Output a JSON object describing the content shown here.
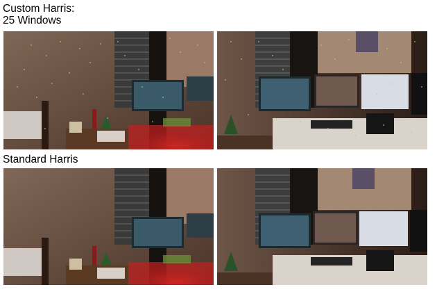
{
  "sections": {
    "custom": {
      "title_line1": "Custom Harris:",
      "title_line2": "25 Windows"
    },
    "standard": {
      "title": "Standard Harris"
    }
  },
  "images": [
    {
      "section": "custom",
      "view": "left-wide",
      "description": "Room corner with bed, christmas tree and red-lit desk with monitors, with corner detection dots"
    },
    {
      "section": "custom",
      "view": "right-wide",
      "description": "Desk with multiple monitors near window, with corner detection dots"
    },
    {
      "section": "standard",
      "view": "left-wide",
      "description": "Room corner with bed, christmas tree and red-lit desk with monitors"
    },
    {
      "section": "standard",
      "view": "right-wide",
      "description": "Desk with multiple monitors near window"
    }
  ],
  "colors": {
    "wall": "#8a6b5a",
    "desk_light": "#c41f1f",
    "monitor": "#3a5a6a",
    "keypoint": "#9fe07a"
  }
}
